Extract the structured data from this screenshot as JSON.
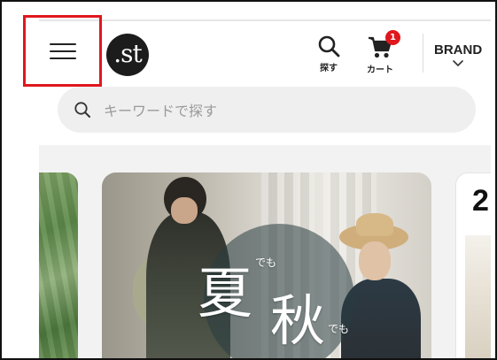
{
  "header": {
    "logo_text": ".st",
    "search_label": "探す",
    "cart_label": "カート",
    "cart_count": "1",
    "brand_label": "BRAND"
  },
  "search": {
    "placeholder": "キーワードで探す"
  },
  "banner": {
    "headline_1": "夏",
    "headline_small_1": "でも",
    "headline_2": "秋",
    "headline_small_2": "でも",
    "next_slide_number": "2"
  },
  "icons": {
    "menu": "hamburger-menu-icon",
    "search": "search-icon",
    "cart": "cart-icon",
    "brand_chevron": "chevron-down-icon",
    "search_field": "search-icon"
  },
  "colors": {
    "accent_red": "#e0171d",
    "logo_bg": "#1c1c1c",
    "search_bg": "#efefef"
  }
}
